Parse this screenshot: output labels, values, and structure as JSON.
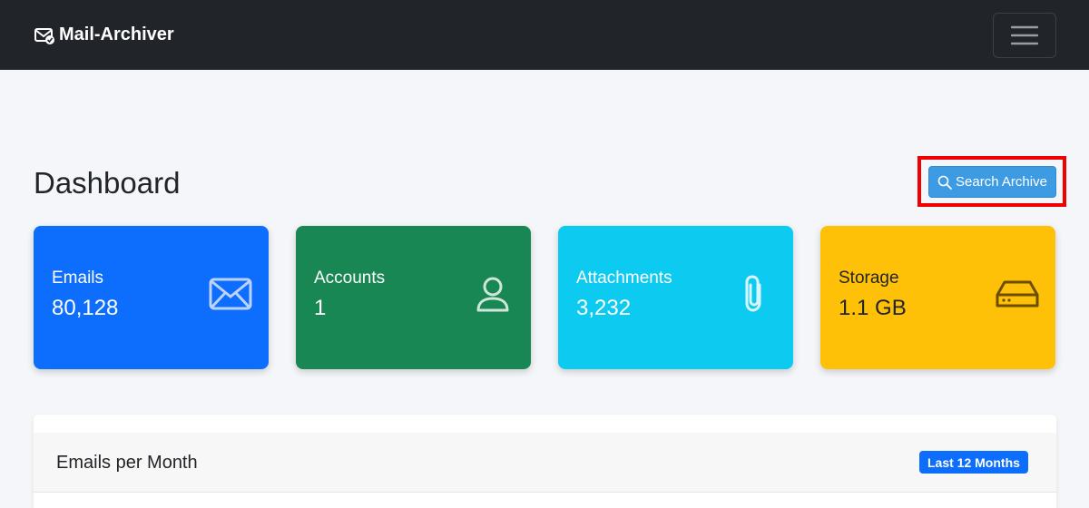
{
  "navbar": {
    "brand": "Mail-Archiver",
    "brand_icon": "envelope-check-icon",
    "toggle_icon": "hamburger-menu-icon"
  },
  "page": {
    "title": "Dashboard"
  },
  "actions": {
    "search_label": "Search Archive",
    "search_icon": "search-icon",
    "highlight_color": "#f00000"
  },
  "stats": [
    {
      "label": "Emails",
      "value": "80,128",
      "icon": "envelope-icon",
      "color": "#0d6efd"
    },
    {
      "label": "Accounts",
      "value": "1",
      "icon": "person-icon",
      "color": "#198754"
    },
    {
      "label": "Attachments",
      "value": "3,232",
      "icon": "paperclip-icon",
      "color": "#0dcaf0"
    },
    {
      "label": "Storage",
      "value": "1.1 GB",
      "icon": "hdd-icon",
      "color": "#ffc107"
    }
  ],
  "chart_panel": {
    "title": "Emails per Month",
    "badge": "Last 12 Months"
  }
}
